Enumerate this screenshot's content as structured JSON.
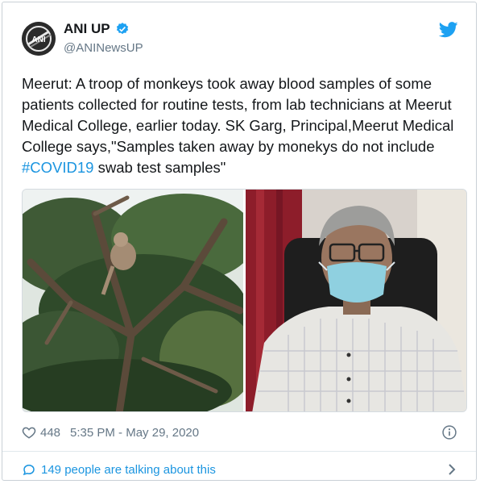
{
  "tweet": {
    "author": {
      "display_name": "ANI UP",
      "handle": "@ANINewsUP",
      "avatar_text": "ANI"
    },
    "text_before": "Meerut: A troop of monkeys took away blood samples of some patients collected for routine tests, from lab technicians at Meerut Medical College, earlier today. SK Garg, Principal,Meerut Medical College says,\"Samples taken away by monekys do not include ",
    "hashtag": "#COVID19",
    "text_after": " swab test samples\"",
    "likes": "448",
    "timestamp": "5:35 PM - May 29, 2020",
    "talking": "149 people are talking about this"
  },
  "colors": {
    "link": "#1b95e0",
    "verified": "#1da1f2",
    "secondary_text": "#657786"
  },
  "icons": [
    "twitter-bird-icon",
    "verified-badge-icon",
    "heart-icon",
    "info-icon",
    "comment-bubble-icon",
    "chevron-right-icon"
  ]
}
